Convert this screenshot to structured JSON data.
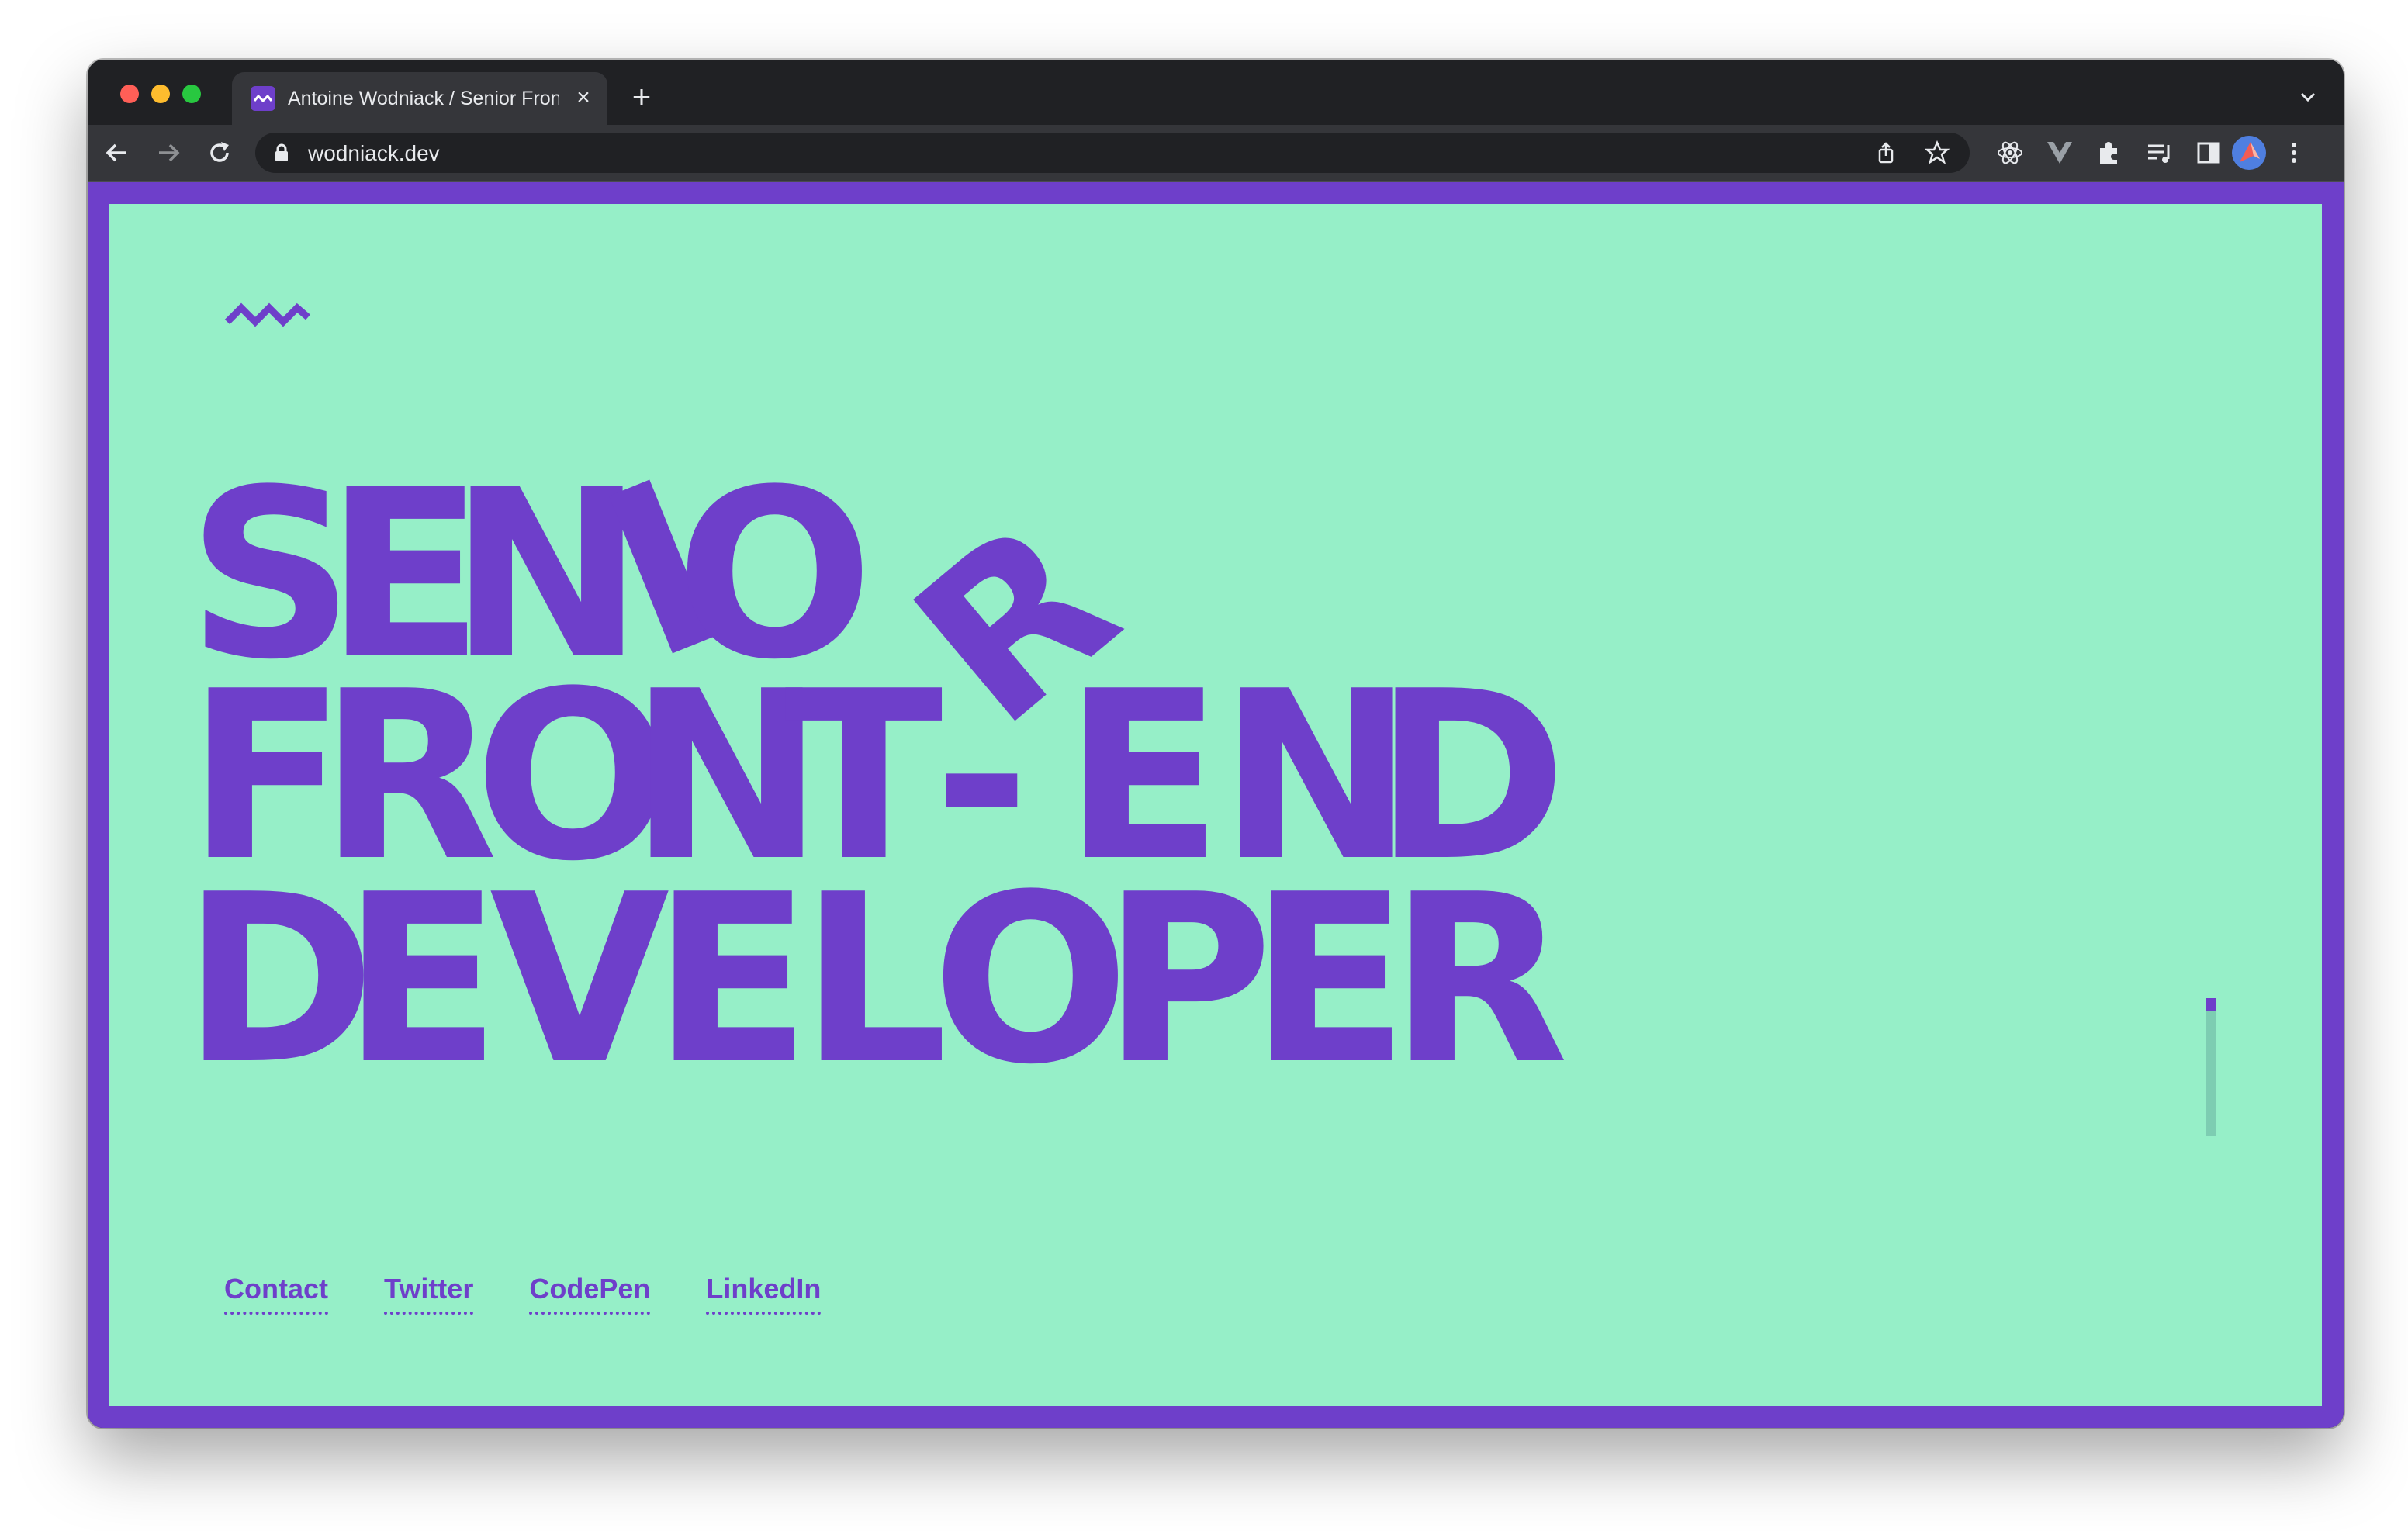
{
  "browser": {
    "tab_title": "Antoine Wodniack / Senior Frontend Developer",
    "new_tab_label": "+",
    "close_label": "×",
    "url": "wodniack.dev"
  },
  "hero": {
    "line1": [
      "S",
      "E",
      "N",
      "I",
      "O",
      "R"
    ],
    "line2": [
      "F",
      "R",
      "O",
      "N",
      "T",
      "-",
      "E",
      "N",
      "D"
    ],
    "line3": [
      "D",
      "E",
      "V",
      "E",
      "L",
      "O",
      "P",
      "E",
      "R"
    ]
  },
  "links": [
    {
      "label": "Contact"
    },
    {
      "label": "Twitter"
    },
    {
      "label": "CodePen"
    },
    {
      "label": "LinkedIn"
    }
  ],
  "icons": {
    "logo": "zigzag-logo-icon",
    "favicon": "zigzag-favicon-icon"
  },
  "colors": {
    "brand_purple": "#6e3fca",
    "background_mint": "#96efc8",
    "chrome_dark": "#202124",
    "chrome_toolbar": "#35363a"
  }
}
